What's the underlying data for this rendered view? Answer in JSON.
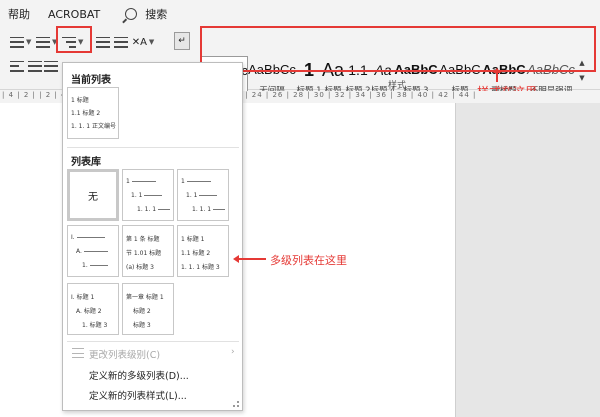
{
  "menubar": {
    "tabs": [
      "帮助",
      "ACROBAT"
    ],
    "search_label": "搜索"
  },
  "ribbon": {
    "styles_group_label": "样式",
    "styles": [
      {
        "sample": "AaBbCc",
        "label": "全部",
        "selected": true
      },
      {
        "sample": "AaBbCc",
        "label": "无间隔"
      },
      {
        "sample": "1",
        "label": "标题 1"
      },
      {
        "sample": "Aa",
        "label": "标题"
      },
      {
        "sample": "1.1",
        "label": "标题 2"
      },
      {
        "sample": "Aa",
        "label": "标题 4"
      },
      {
        "sample": "AaBbC",
        "label": "标题 3"
      },
      {
        "sample": "AaBbC",
        "label": "标题"
      },
      {
        "sample": "AaBbC",
        "label": "副标题"
      },
      {
        "sample": "AaBbCc",
        "label": "不明显强调"
      }
    ]
  },
  "annotations": {
    "styles_here": "样式在这里",
    "multilevel_here": "多级列表在这里"
  },
  "ruler_text": "| 4 | 2 |  | 2 | 4 | 6 | 8 | 10 | 12 | 14 | 16 | 18 | 20 | 22 | 24 | 26 | 28 | 30 | 32 | 34 | 36 | 38 | 40 | 42 | 44 |",
  "dropdown": {
    "current_title": "当前列表",
    "current_list": [
      "1 标题",
      "1.1 标题 2",
      "1. 1. 1 正文编号"
    ],
    "library_title": "列表库",
    "none_label": "无",
    "library": [
      {
        "lines": [
          "1",
          "1. 1",
          "1. 1. 1"
        ]
      },
      {
        "lines": [
          "1",
          "1. 1",
          "1. 1. 1"
        ]
      },
      {
        "lines": [
          "I.",
          "A.",
          "1."
        ]
      },
      {
        "lines": [
          "第 1 条 标题",
          "节 1.01 标题",
          "(a) 标题 3"
        ]
      },
      {
        "lines": [
          "1 标题 1",
          "1.1 标题 2",
          "1. 1. 1 标题 3"
        ]
      },
      {
        "lines": [
          "I. 标题 1",
          "A. 标题 2",
          "1. 标题 3"
        ]
      },
      {
        "lines": [
          "第一章 标题 1",
          "标题 2",
          "标题 3"
        ]
      }
    ],
    "change_level": "更改列表级别(C)",
    "define_multilevel": "定义新的多级列表(D)...",
    "define_style": "定义新的列表样式(L)..."
  }
}
